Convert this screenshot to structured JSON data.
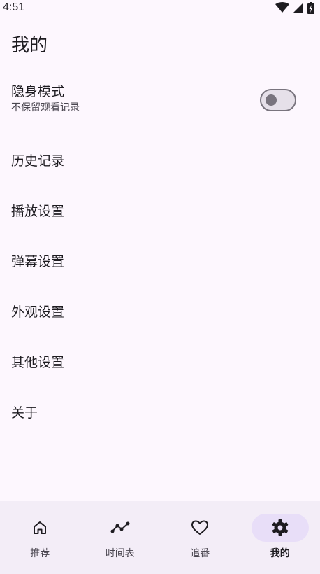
{
  "status_bar": {
    "time": "4:51"
  },
  "page": {
    "title": "我的"
  },
  "incognito": {
    "title": "隐身模式",
    "subtitle": "不保留观看记录",
    "enabled": false
  },
  "menu": [
    {
      "label": "历史记录"
    },
    {
      "label": "播放设置"
    },
    {
      "label": "弹幕设置"
    },
    {
      "label": "外观设置"
    },
    {
      "label": "其他设置"
    },
    {
      "label": "关于"
    }
  ],
  "nav": [
    {
      "label": "推荐",
      "icon": "home-icon",
      "active": false
    },
    {
      "label": "时间表",
      "icon": "timeline-icon",
      "active": false
    },
    {
      "label": "追番",
      "icon": "heart-icon",
      "active": false
    },
    {
      "label": "我的",
      "icon": "gear-icon",
      "active": true
    }
  ],
  "colors": {
    "background": "#fdf7fe",
    "nav_background": "#f3edf7",
    "nav_active_indicator": "#e8def8",
    "text_primary": "#1d1b20",
    "text_secondary": "#49454f",
    "toggle_outline": "#79747e"
  }
}
